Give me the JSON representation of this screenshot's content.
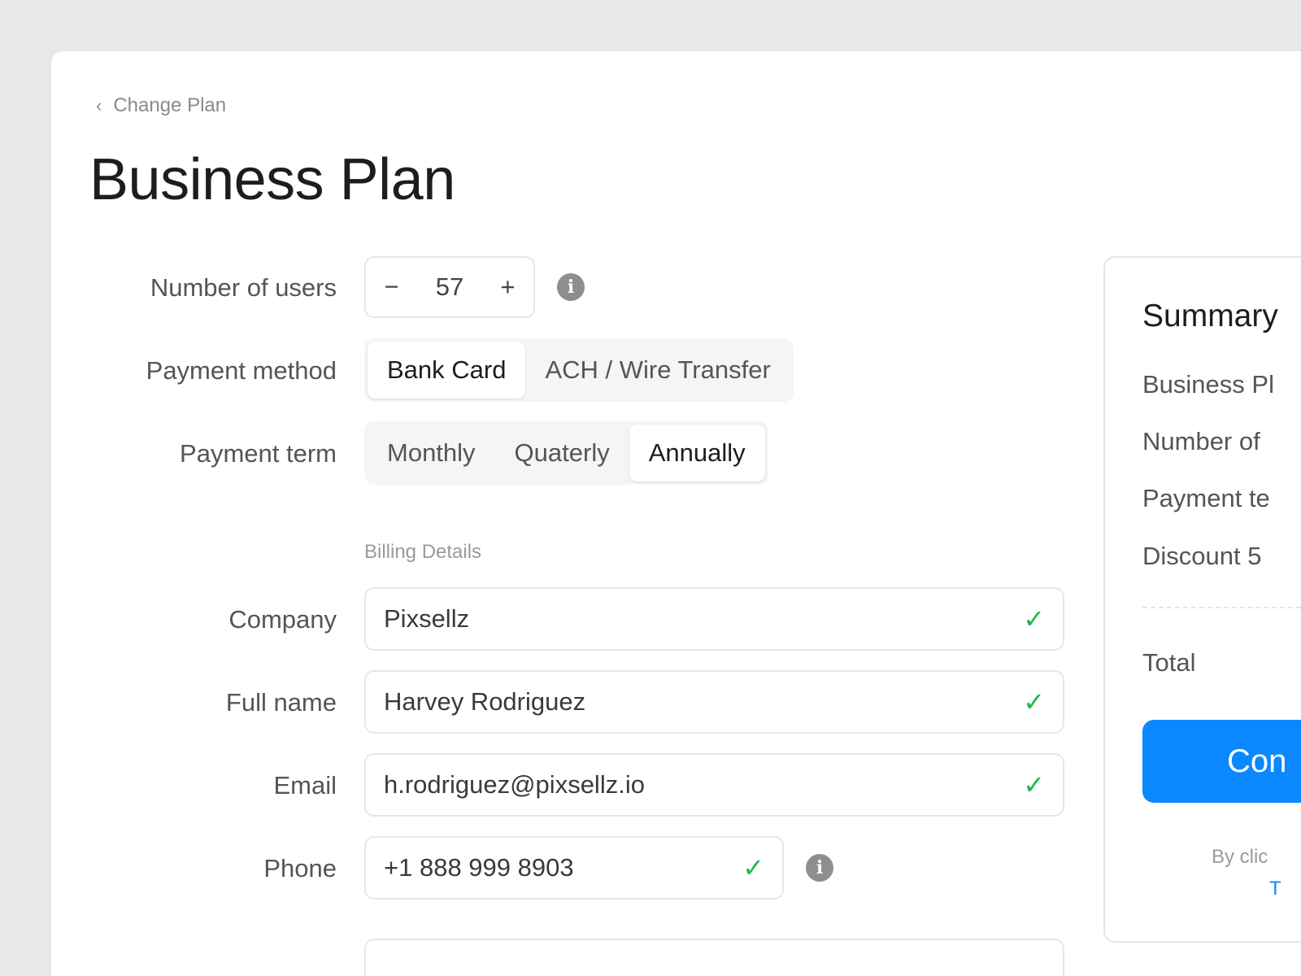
{
  "back_link": "Change Plan",
  "title": "Business Plan",
  "users": {
    "label": "Number of users",
    "value": "57",
    "minus": "−",
    "plus": "+"
  },
  "payment_method": {
    "label": "Payment method",
    "options": [
      "Bank Card",
      "ACH / Wire Transfer"
    ],
    "selected": "Bank Card"
  },
  "payment_term": {
    "label": "Payment term",
    "options": [
      "Monthly",
      "Quaterly",
      "Annually"
    ],
    "selected": "Annually"
  },
  "billing": {
    "section": "Billing Details",
    "company": {
      "label": "Company",
      "value": "Pixsellz"
    },
    "full_name": {
      "label": "Full name",
      "value": "Harvey Rodriguez"
    },
    "email": {
      "label": "Email",
      "value": "h.rodriguez@pixsellz.io"
    },
    "phone": {
      "label": "Phone",
      "value": "+1 888 999 8903"
    }
  },
  "summary": {
    "title": "Summary",
    "rows": [
      "Business Pl",
      "Number of",
      "Payment te",
      "Discount 5"
    ],
    "total": "Total",
    "button": "Con",
    "note": "By clic",
    "link": "T"
  },
  "colors": {
    "accent": "#0a88ff",
    "valid": "#1eb84a",
    "background": "#e8e8e8"
  },
  "icons": {
    "back": "chevron-left-icon",
    "info": "info-icon",
    "valid": "check-icon"
  }
}
